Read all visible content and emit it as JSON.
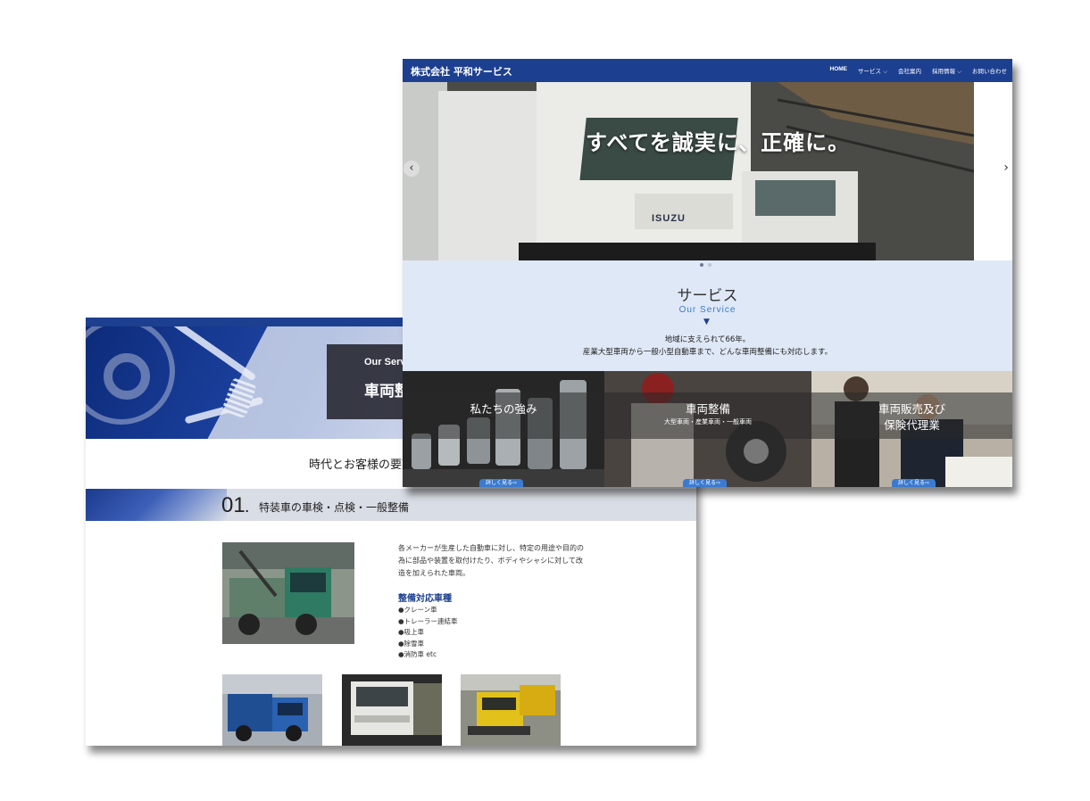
{
  "front": {
    "brand": "株式会社 平和サービス",
    "nav": [
      "HOME",
      "サービス ⌵",
      "会社案内",
      "採用情報 ⌵",
      "お問い合わせ"
    ],
    "hero_text": "すべてを誠実に、正確に。",
    "hero_truck_logo": "ISUZU",
    "arrow_prev": "‹",
    "arrow_next": "›",
    "slide_count": 2,
    "active_slide": 1,
    "service": {
      "title": "サービス",
      "subtitle": "Our Service",
      "marker": "▼",
      "lead_1": "地域に支えられて66年。",
      "lead_2": "産業大型車両から一般小型自動車まで、どんな車両整備にも対応します。"
    },
    "cards": [
      {
        "title": "私たちの強み",
        "title_2": "",
        "subtitle": "",
        "more": "詳しく見る⇨"
      },
      {
        "title": "車両整備",
        "title_2": "",
        "subtitle": "大型車両・産業車両・一般車両",
        "more": "詳しく見る⇨"
      },
      {
        "title": "車両販売及び",
        "title_2": "保険代理業",
        "subtitle": "",
        "more": "詳しく見る⇨"
      }
    ]
  },
  "back": {
    "hero_en": "Our Serv",
    "hero_jp": "車両整",
    "lead": "時代とお客様の要望",
    "section": {
      "number": "01",
      "dot": ".",
      "title": "特装車の車検・点検・一般整備"
    },
    "description": "各メーカーが生産した自動車に対し、特定の用途や目的の為に部品や装置を取付けたり、ボディやシャシに対して改造を加えられた車両。",
    "types_heading": "整備対応車種",
    "types": [
      "●クレーン車",
      "●トレーラー連結車",
      "●吸上車",
      "●除雪車",
      "●消防車 etc"
    ]
  },
  "colors": {
    "brand_navy": "#1d3f8f",
    "accent_blue": "#3a7bd0",
    "service_bg": "#dfe8f6",
    "section_band": "#d9dde5"
  }
}
